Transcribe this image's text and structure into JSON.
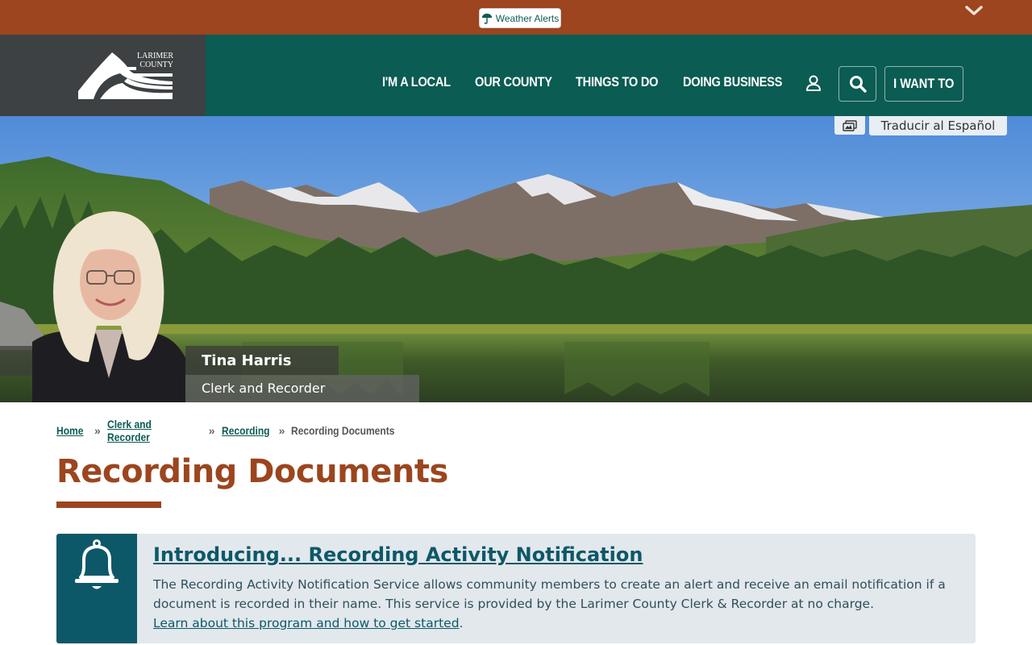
{
  "alert_bar": {
    "weather_label": "Weather Alerts"
  },
  "header": {
    "logo_line1": "LARIMER",
    "logo_line2": "COUNTY",
    "nav": [
      "I'M A LOCAL",
      "OUR COUNTY",
      "THINGS TO DO",
      "DOING BUSINESS"
    ],
    "i_want_to": "I WANT TO"
  },
  "hero": {
    "translate_label": "Traducir al Español",
    "person_name": "Tina Harris",
    "person_title": "Clerk and Recorder"
  },
  "breadcrumb": {
    "items": [
      "Home",
      "Clerk and Recorder",
      "Recording"
    ],
    "current": "Recording Documents",
    "separator": "»"
  },
  "page": {
    "title": "Recording Documents"
  },
  "notice": {
    "title": "Introducing... Recording Activity Notification",
    "body": "The Recording Activity Notification Service allows community members to create an alert and receive an email notification if a document is recorded in their name. This service is provided by the Larimer County Clerk & Recorder at no charge.",
    "link": "Learn about this program and how to get started",
    "link_suffix": "."
  },
  "colors": {
    "alert_bar": "#9c451e",
    "header": "#0b5c52",
    "logo_box": "#3d4143",
    "accent_title": "#9c451e",
    "notice_icon_bg": "#0d5868",
    "notice_bg": "#e2e8ec"
  }
}
